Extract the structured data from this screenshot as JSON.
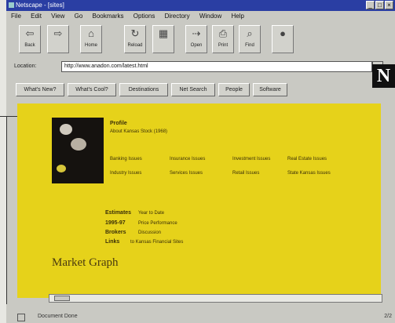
{
  "window": {
    "title": "Netscape - [sites]",
    "controls": [
      "_",
      "□",
      "×"
    ]
  },
  "menu": [
    "File",
    "Edit",
    "View",
    "Go",
    "Bookmarks",
    "Options",
    "Directory",
    "Window",
    "Help"
  ],
  "toolbar": [
    {
      "label": "Back",
      "icon": "back-icon",
      "glyph": "⇦"
    },
    {
      "label": "",
      "icon": "forward-icon",
      "glyph": "⇨"
    },
    {
      "label": "Home",
      "icon": "home-icon",
      "glyph": "⌂"
    },
    {
      "label": "Reload",
      "icon": "reload-icon",
      "glyph": "↻"
    },
    {
      "label": "",
      "icon": "images-icon",
      "glyph": "▦"
    },
    {
      "label": "Open",
      "icon": "open-icon",
      "glyph": "⇢"
    },
    {
      "label": "Print",
      "icon": "print-icon",
      "glyph": "⎙"
    },
    {
      "label": "Find",
      "icon": "find-icon",
      "glyph": "⌕"
    },
    {
      "label": "",
      "icon": "stop-icon",
      "glyph": "●"
    }
  ],
  "location": {
    "label": "Location:",
    "url": "http://www.anadon.com/latest.html"
  },
  "logo": "N",
  "directory_buttons": [
    "What's New?",
    "What's Cool?",
    "Destinations",
    "Net Search",
    "People",
    "Software"
  ],
  "content": {
    "section1_head": "Profile",
    "section1_sub": "About Kansas Stock (1968)",
    "links_row1": [
      "Banking Issues",
      "Insurance Issues",
      "Investment Issues",
      "Real Estate Issues"
    ],
    "links_row2": [
      "Industry Issues",
      "Services Issues",
      "Retail Issues",
      "State Kansas Issues"
    ],
    "section2": [
      {
        "head": "Estimates",
        "text": "Year to Date"
      },
      {
        "head": "1995-97",
        "text": "Price Performance"
      },
      {
        "head": "Brokers",
        "text": "Discussion"
      },
      {
        "head": "Links",
        "text": "to Kansas Financial Sites"
      }
    ],
    "graph_title": "Market Graph"
  },
  "status": {
    "text": "Document Done",
    "right": "2/2"
  },
  "colors": {
    "accent": "#e6d21a",
    "titlebar": "#2a3ea3"
  }
}
